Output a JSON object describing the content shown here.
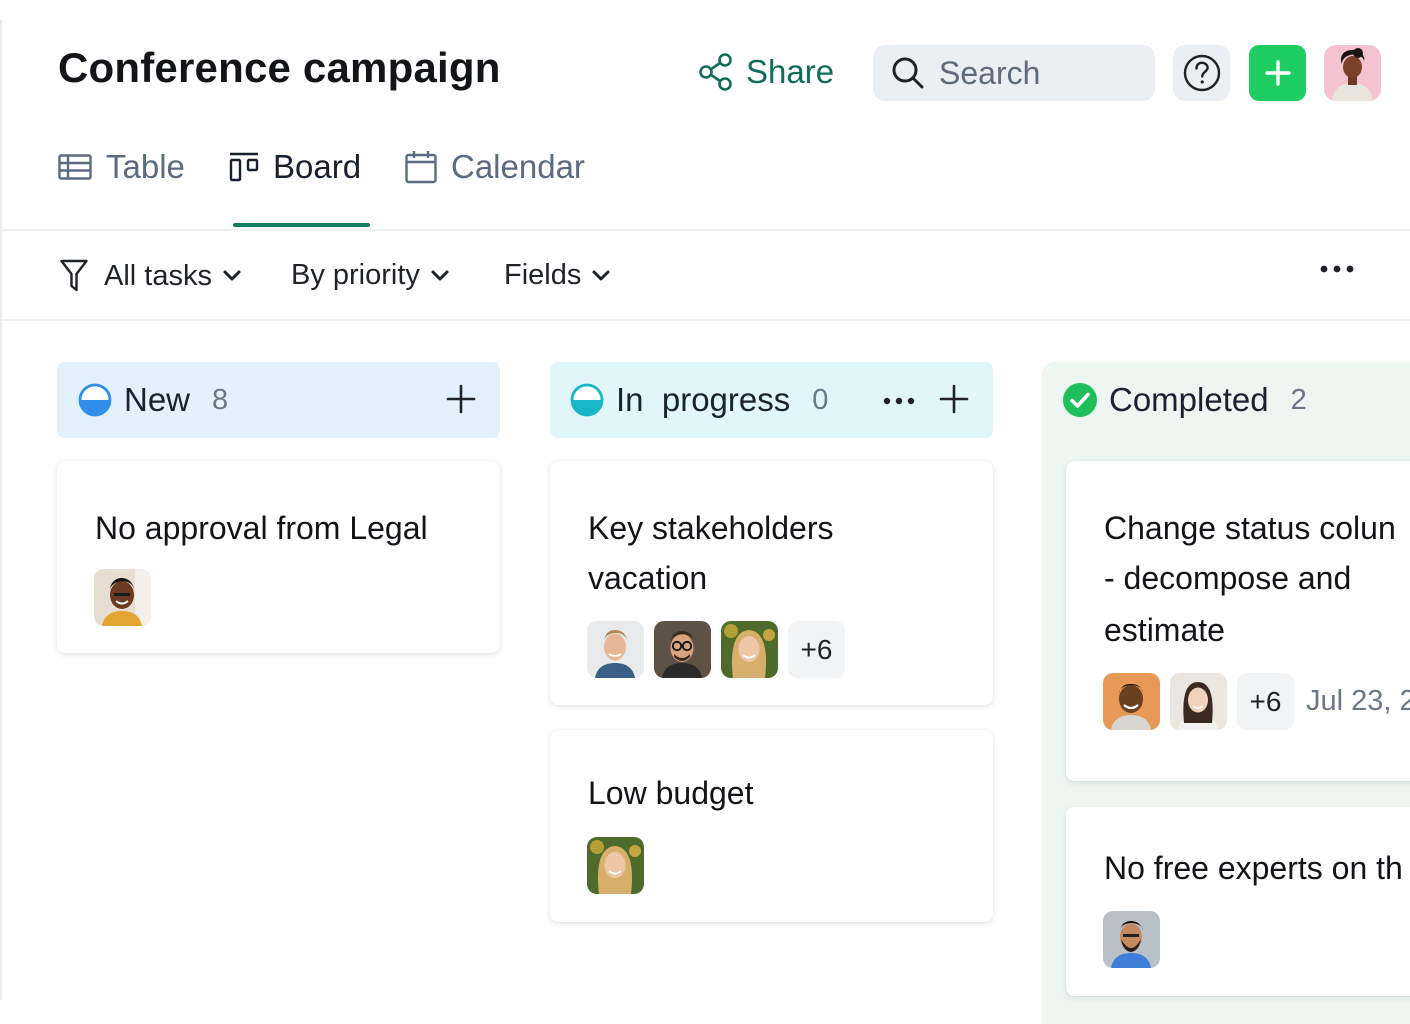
{
  "header": {
    "title": "Conference campaign",
    "share_label": "Share",
    "search_placeholder": "Search"
  },
  "tabs": [
    {
      "label": "Table",
      "icon": "table-icon",
      "active": false
    },
    {
      "label": "Board",
      "icon": "board-icon",
      "active": true
    },
    {
      "label": "Calendar",
      "icon": "calendar-icon",
      "active": false
    }
  ],
  "filters": {
    "tasks_label": "All tasks",
    "group_label": "By priority",
    "fields_label": "Fields"
  },
  "columns": [
    {
      "name": "New",
      "count": "8",
      "color": "#e3f1fc",
      "cards": [
        {
          "title": "No approval from Legal",
          "avatars": [
            "avatar-woman-smiling"
          ]
        }
      ]
    },
    {
      "name": "In  progress",
      "count": "0",
      "color": "#e0f6f8",
      "cards": [
        {
          "title_lines": [
            "Key stakeholders",
            "vacation"
          ],
          "avatars": [
            "avatar-man-blond",
            "avatar-man-glasses",
            "avatar-woman-blonde"
          ],
          "more": "+6"
        },
        {
          "title": "Low budget",
          "avatars": [
            "avatar-woman-blonde"
          ]
        }
      ]
    },
    {
      "name": "Completed",
      "count": "2",
      "color": "#eef6f2",
      "cards": [
        {
          "title_lines": [
            "Change status colun",
            "- decompose and",
            "estimate"
          ],
          "avatars": [
            "avatar-man-smiling",
            "avatar-woman-asian"
          ],
          "more": "+6",
          "date": "Jul 23, 2"
        },
        {
          "title": "No free experts on th",
          "avatars": [
            "avatar-man-beard"
          ]
        }
      ]
    }
  ],
  "colors": {
    "accent_green": "#1fce62",
    "tab_underline": "#128060",
    "share_text": "#0f6d5b"
  }
}
